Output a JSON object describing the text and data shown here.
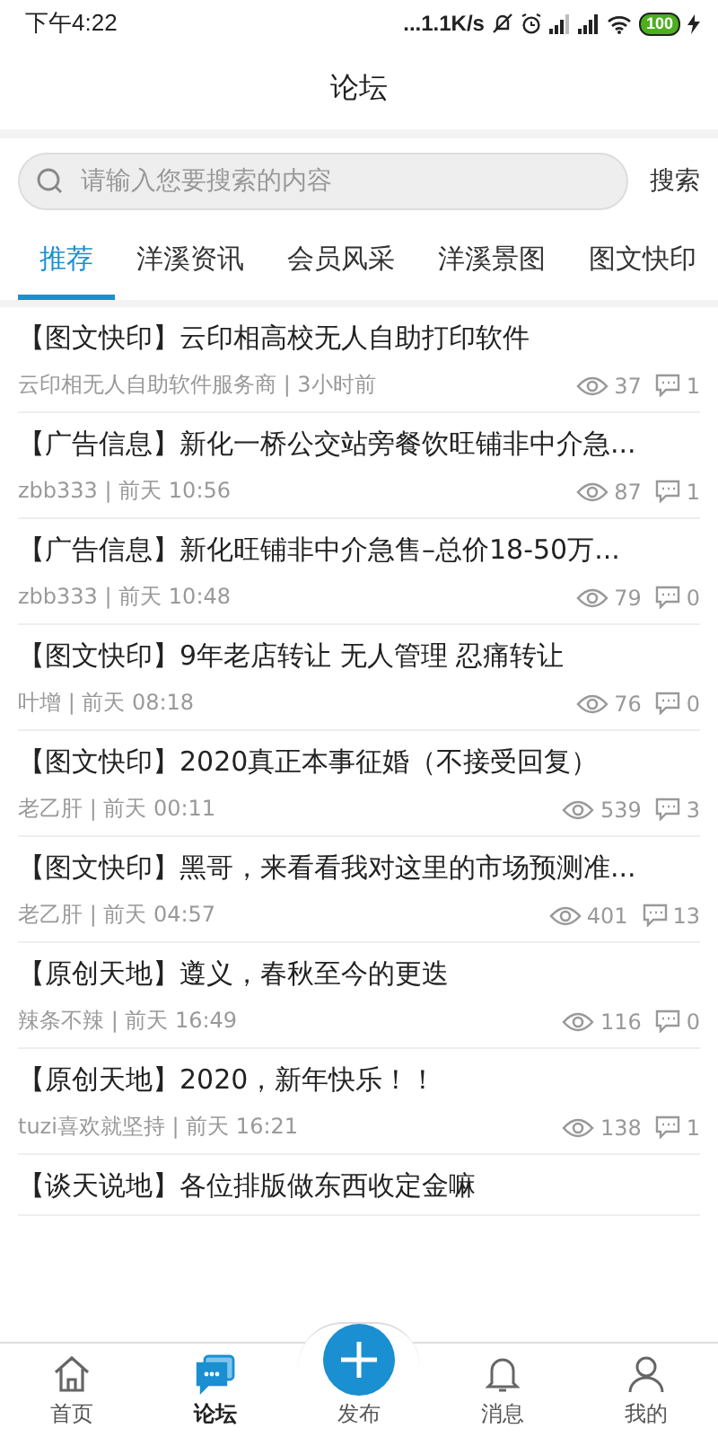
{
  "status_bar": {
    "time": "下午4:22",
    "speed": "...1.1K/s",
    "battery": "100"
  },
  "header": {
    "title": "论坛"
  },
  "search": {
    "placeholder": "请输入您要搜索的内容",
    "button": "搜索"
  },
  "tabs": [
    {
      "label": "推荐",
      "selected": true
    },
    {
      "label": "洋溪资讯",
      "selected": false
    },
    {
      "label": "会员风采",
      "selected": false
    },
    {
      "label": "洋溪景图",
      "selected": false
    },
    {
      "label": "图文快印",
      "selected": false
    }
  ],
  "posts": [
    {
      "title": "【图文快印】云印相高校无人自助打印软件",
      "meta": "云印相无人自助软件服务商 | 3小时前",
      "views": "37",
      "comments": "1"
    },
    {
      "title": "【广告信息】新化一桥公交站旁餐饮旺铺非中介急...",
      "meta": "zbb333 | 前天 10:56",
      "views": "87",
      "comments": "1"
    },
    {
      "title": "【广告信息】新化旺铺非中介急售–总价18-50万...",
      "meta": "zbb333 | 前天 10:48",
      "views": "79",
      "comments": "0"
    },
    {
      "title": "【图文快印】9年老店转让 无人管理 忍痛转让",
      "meta": "叶增 | 前天 08:18",
      "views": "76",
      "comments": "0"
    },
    {
      "title": "【图文快印】2020真正本事征婚（不接受回复）",
      "meta": "老乙肝 | 前天 00:11",
      "views": "539",
      "comments": "3"
    },
    {
      "title": "【图文快印】黑哥，来看看我对这里的市场预测准...",
      "meta": "老乙肝 | 前天 04:57",
      "views": "401",
      "comments": "13"
    },
    {
      "title": "【原创天地】遵义，春秋至今的更迭",
      "meta": "辣条不辣 | 前天 16:49",
      "views": "116",
      "comments": "0"
    },
    {
      "title": "【原创天地】2020，新年快乐！！",
      "meta": "tuzi喜欢就坚持 | 前天 16:21",
      "views": "138",
      "comments": "1"
    },
    {
      "title": "【谈天说地】各位排版做东西收定金嘛"
    }
  ],
  "bottom_nav": [
    {
      "label": "首页",
      "kind": "home",
      "selected": false
    },
    {
      "label": "论坛",
      "kind": "forum",
      "selected": true
    },
    {
      "label": "发布",
      "kind": "publish",
      "selected": false
    },
    {
      "label": "消息",
      "kind": "bell",
      "selected": false
    },
    {
      "label": "我的",
      "kind": "person",
      "selected": false
    }
  ]
}
